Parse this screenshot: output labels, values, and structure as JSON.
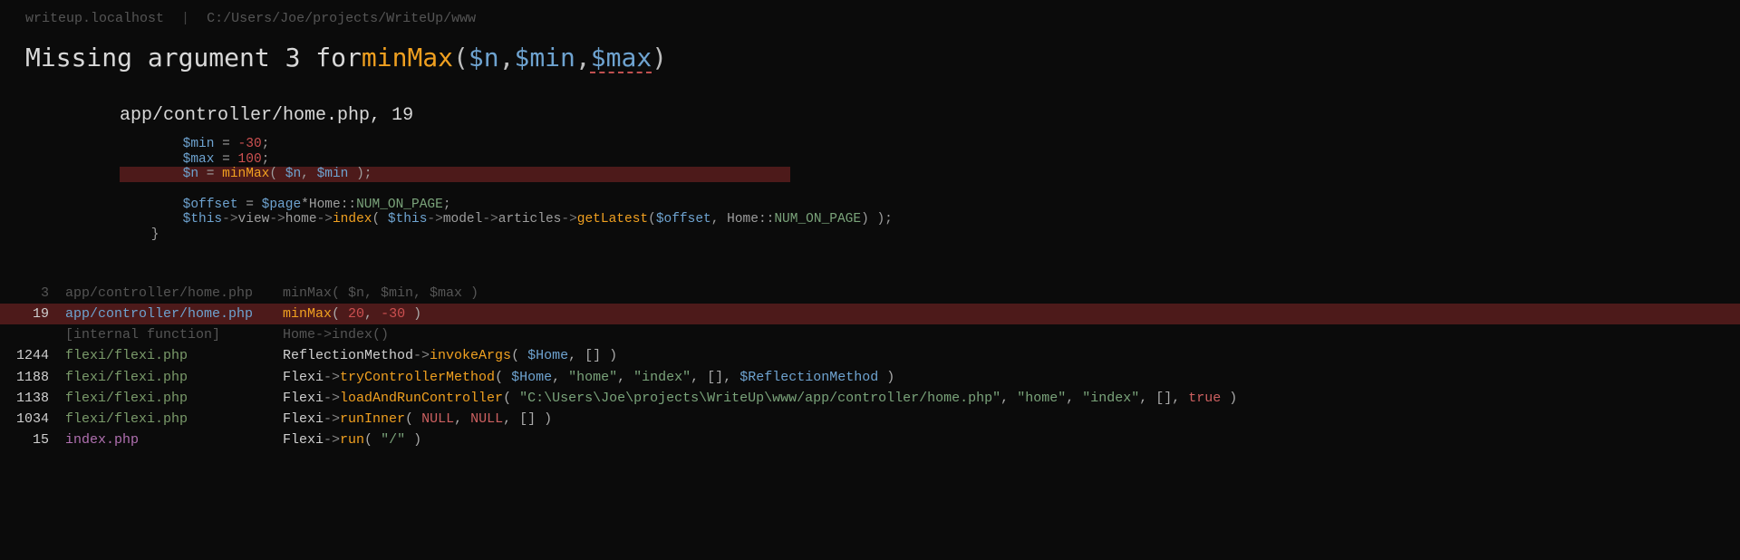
{
  "breadcrumb": {
    "host": "writeup.localhost",
    "sep": "|",
    "path": "C:/Users/Joe/projects/WriteUp/www"
  },
  "error": {
    "prefix": "Missing argument 3 for ",
    "fn": "minMax",
    "open": "( ",
    "arg1": "$n",
    "comma": ", ",
    "arg2": "$min",
    "arg3": "$max",
    "close": " )"
  },
  "source": {
    "file": "app/controller/home.php",
    "line": "19"
  },
  "code": {
    "l1": {
      "indent": "        ",
      "var": "$min",
      "rest": " = ",
      "num": "-30",
      "end": ";"
    },
    "l2": {
      "indent": "        ",
      "var": "$max",
      "rest": " = ",
      "num": "100",
      "end": ";"
    },
    "l3": {
      "indent": "        ",
      "var1": "$n",
      "eq": " = ",
      "fn": "minMax",
      "open": "( ",
      "var2": "$n",
      "sep": ", ",
      "var3": "$min",
      "close": " );"
    },
    "l4": " ",
    "l5": {
      "indent": "        ",
      "var": "$offset",
      "eq": " = ",
      "var2": "$page",
      "mul": "*",
      "cls": "Home",
      "scope": "::",
      "const": "NUM_ON_PAGE",
      "end": ";"
    },
    "l6": {
      "indent": "        ",
      "this": "$this",
      "arrow": "->",
      "view": "view",
      "home": "home",
      "idx": "index",
      "open": "( ",
      "this2": "$this",
      "model": "model",
      "articles": "articles",
      "getLatest": "getLatest",
      "open2": "(",
      "off": "$offset",
      "sep": ", ",
      "cls": "Home",
      "scope": "::",
      "const": "NUM_ON_PAGE",
      "close": ") );"
    },
    "l7": "    }"
  },
  "stack": [
    {
      "num": "3",
      "file": "app/controller/home.php",
      "fileClass": "home",
      "dim": true,
      "sel": false,
      "call": {
        "cls": "",
        "op": "",
        "method": "minMax",
        "args": "(  $n,  $min,  $max )"
      }
    },
    {
      "num": "19",
      "file": "app/controller/home.php",
      "fileClass": "home",
      "dim": false,
      "sel": true,
      "call": {
        "cls": "",
        "op": "",
        "method": "minMax",
        "open": "( ",
        "a1": "20",
        "sep": ", ",
        "a2": "-30",
        "close": " )"
      }
    },
    {
      "num": "",
      "file": "[internal function]",
      "fileClass": "",
      "dim": true,
      "sel": false,
      "call": {
        "cls": "Home",
        "op": "->",
        "method": "index",
        "args": "()"
      }
    },
    {
      "num": "1244",
      "file": "flexi/flexi.php",
      "fileClass": "flx",
      "dim": false,
      "sel": false,
      "call": {
        "cls": "ReflectionMethod",
        "op": "->",
        "method": "invokeArgs",
        "open": "( ",
        "v1": "$Home",
        "sep": ", ",
        "rest": "[] )"
      }
    },
    {
      "num": "1188",
      "file": "flexi/flexi.php",
      "fileClass": "flx",
      "dim": false,
      "sel": false,
      "call": {
        "cls": "Flexi",
        "op": "->",
        "method": "tryControllerMethod",
        "open": "( ",
        "v1": "$Home",
        "sep": ", ",
        "s1": "\"home\"",
        "s2": "\"index\"",
        "arr": "[]",
        "v2": "$ReflectionMethod",
        "close": " )"
      }
    },
    {
      "num": "1138",
      "file": "flexi/flexi.php",
      "fileClass": "flx",
      "dim": false,
      "sel": false,
      "call": {
        "cls": "Flexi",
        "op": "->",
        "method": "loadAndRunController",
        "open": "( ",
        "s1": "\"C:\\Users\\Joe\\projects\\WriteUp\\www/app/controller/home.php\"",
        "s2": "\"home\"",
        "s3": "\"index\"",
        "arr": "[]",
        "b": "true",
        "close": " )"
      }
    },
    {
      "num": "1034",
      "file": "flexi/flexi.php",
      "fileClass": "flx",
      "dim": false,
      "sel": false,
      "call": {
        "cls": "Flexi",
        "op": "->",
        "method": "runInner",
        "open": "( ",
        "n1": "NULL",
        "n2": "NULL",
        "arr": "[] )"
      }
    },
    {
      "num": "15",
      "file": "index.php",
      "fileClass": "idx",
      "dim": false,
      "sel": false,
      "call": {
        "cls": "Flexi",
        "op": "->",
        "method": "run",
        "open": "( ",
        "s1": "\"/\"",
        "close": " )"
      }
    }
  ]
}
